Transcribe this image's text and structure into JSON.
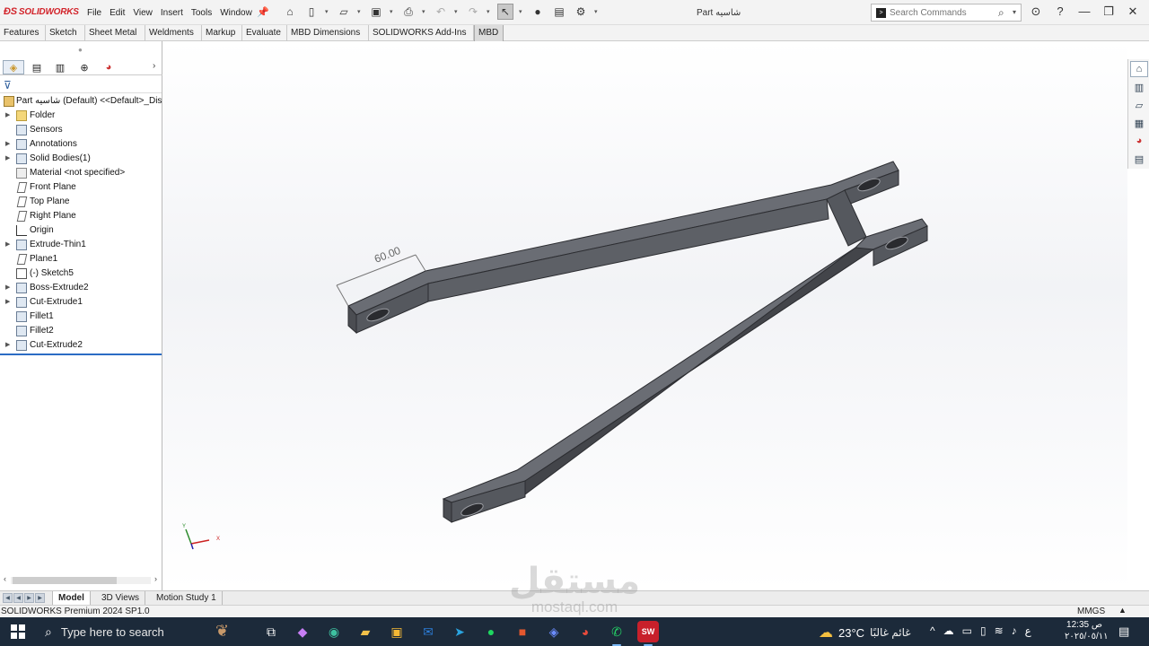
{
  "app": {
    "logo": "SOLIDWORKS",
    "menu": [
      "File",
      "Edit",
      "View",
      "Insert",
      "Tools",
      "Window"
    ],
    "document_title": "Part شاسيه",
    "search": {
      "placeholder": "Search Commands"
    }
  },
  "command_tabs": [
    {
      "label": "Features"
    },
    {
      "label": "Sketch"
    },
    {
      "label": "Sheet Metal"
    },
    {
      "label": "Weldments"
    },
    {
      "label": "Markup"
    },
    {
      "label": "Evaluate"
    },
    {
      "label": "MBD Dimensions"
    },
    {
      "label": "SOLIDWORKS Add-Ins"
    },
    {
      "label": "MBD",
      "active": true
    }
  ],
  "feature_tree": {
    "root": "Part شاسيه (Default) <<Default>_Dis",
    "items": [
      {
        "label": "Folder",
        "icon": "folder-icon",
        "expandable": true
      },
      {
        "label": "Sensors",
        "icon": "sensors-icon",
        "expandable": false
      },
      {
        "label": "Annotations",
        "icon": "annotations-icon",
        "expandable": true
      },
      {
        "label": "Solid Bodies(1)",
        "icon": "solid-bodies-icon",
        "expandable": true
      },
      {
        "label": "Material <not specified>",
        "icon": "material-icon",
        "expandable": false
      },
      {
        "label": "Front Plane",
        "icon": "plane-icon",
        "expandable": false
      },
      {
        "label": "Top Plane",
        "icon": "plane-icon",
        "expandable": false
      },
      {
        "label": "Right Plane",
        "icon": "plane-icon",
        "expandable": false
      },
      {
        "label": "Origin",
        "icon": "origin-icon",
        "expandable": false
      },
      {
        "label": "Extrude-Thin1",
        "icon": "extrude-icon",
        "expandable": true
      },
      {
        "label": "Plane1",
        "icon": "plane-icon",
        "expandable": false
      },
      {
        "label": "(-) Sketch5",
        "icon": "sketch-icon",
        "expandable": false
      },
      {
        "label": "Boss-Extrude2",
        "icon": "extrude-icon",
        "expandable": true
      },
      {
        "label": "Cut-Extrude1",
        "icon": "cut-extrude-icon",
        "expandable": true
      },
      {
        "label": "Fillet1",
        "icon": "fillet-icon",
        "expandable": false
      },
      {
        "label": "Fillet2",
        "icon": "fillet-icon",
        "expandable": false
      },
      {
        "label": "Cut-Extrude2",
        "icon": "cut-extrude-icon",
        "expandable": true
      }
    ]
  },
  "viewport": {
    "dimension_label": "60.00",
    "triad": {
      "x": "X",
      "y": "Y"
    }
  },
  "model_tabs": [
    {
      "label": "Model",
      "active": true
    },
    {
      "label": "3D Views"
    },
    {
      "label": "Motion Study 1"
    }
  ],
  "status_bar": {
    "text": "SOLIDWORKS Premium 2024 SP1.0",
    "units": "MMGS"
  },
  "taskbar": {
    "search_placeholder": "Type here to search",
    "weather_temp": "23°C",
    "weather_desc": "غائم غالبًا",
    "clock_time": "12:35 ص",
    "clock_date": "٢٠٢٥/٠٥/١١",
    "language": "ع"
  },
  "watermark": {
    "arabic": "مستقل",
    "latin": "mostaql.com"
  },
  "colors": {
    "model_face": "#5c5f66",
    "model_side": "#3b3d42",
    "selection_accent": "#2b6cc4",
    "taskbar": "#1c2a3a"
  }
}
